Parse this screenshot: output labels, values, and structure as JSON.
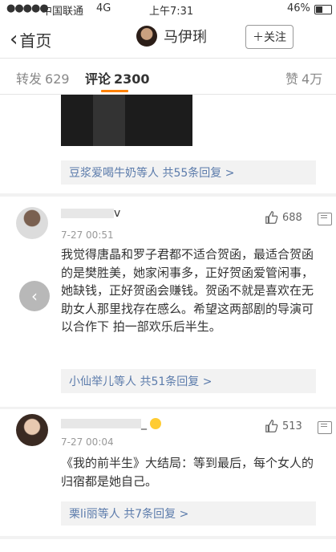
{
  "status_bar": {
    "signal": "●●●●●",
    "carrier": "中国联通",
    "network": "4G",
    "time": "上午7:31",
    "battery_text": "46%",
    "battery_level": 0.46
  },
  "nav": {
    "back_label": "首页",
    "username": "马伊琍",
    "follow_label": "＋关注"
  },
  "tabs": [
    {
      "label": "转发",
      "count": "629"
    },
    {
      "label": "评论",
      "count": "2300"
    },
    {
      "label": "赞",
      "count": "4万"
    }
  ],
  "active_tab": 1,
  "top_card": {
    "replies_label": "豆浆爱喝牛奶等人  共55条回复 >"
  },
  "comments": [
    {
      "name_suffix": "v",
      "time": "7-27 00:51",
      "likes": "688",
      "text": "我觉得唐晶和罗子君都不适合贺函，最适合贺函的是樊胜美，她家闲事多，正好贺函爱管闲事，她缺钱，正好贺函会赚钱。贺函不就是喜欢在无助女人那里找存在感么。希望这两部剧的导演可以合作下 拍一部欢乐后半生。",
      "replies_label": "小仙举儿等人  共51条回复 >"
    },
    {
      "name_suffix": "_",
      "time": "7-27 00:04",
      "likes": "513",
      "text": "《我的前半生》大结局：等到最后，每个女人的归宿都是她自己。",
      "replies_label": "栗li丽等人  共7条回复 >"
    }
  ]
}
